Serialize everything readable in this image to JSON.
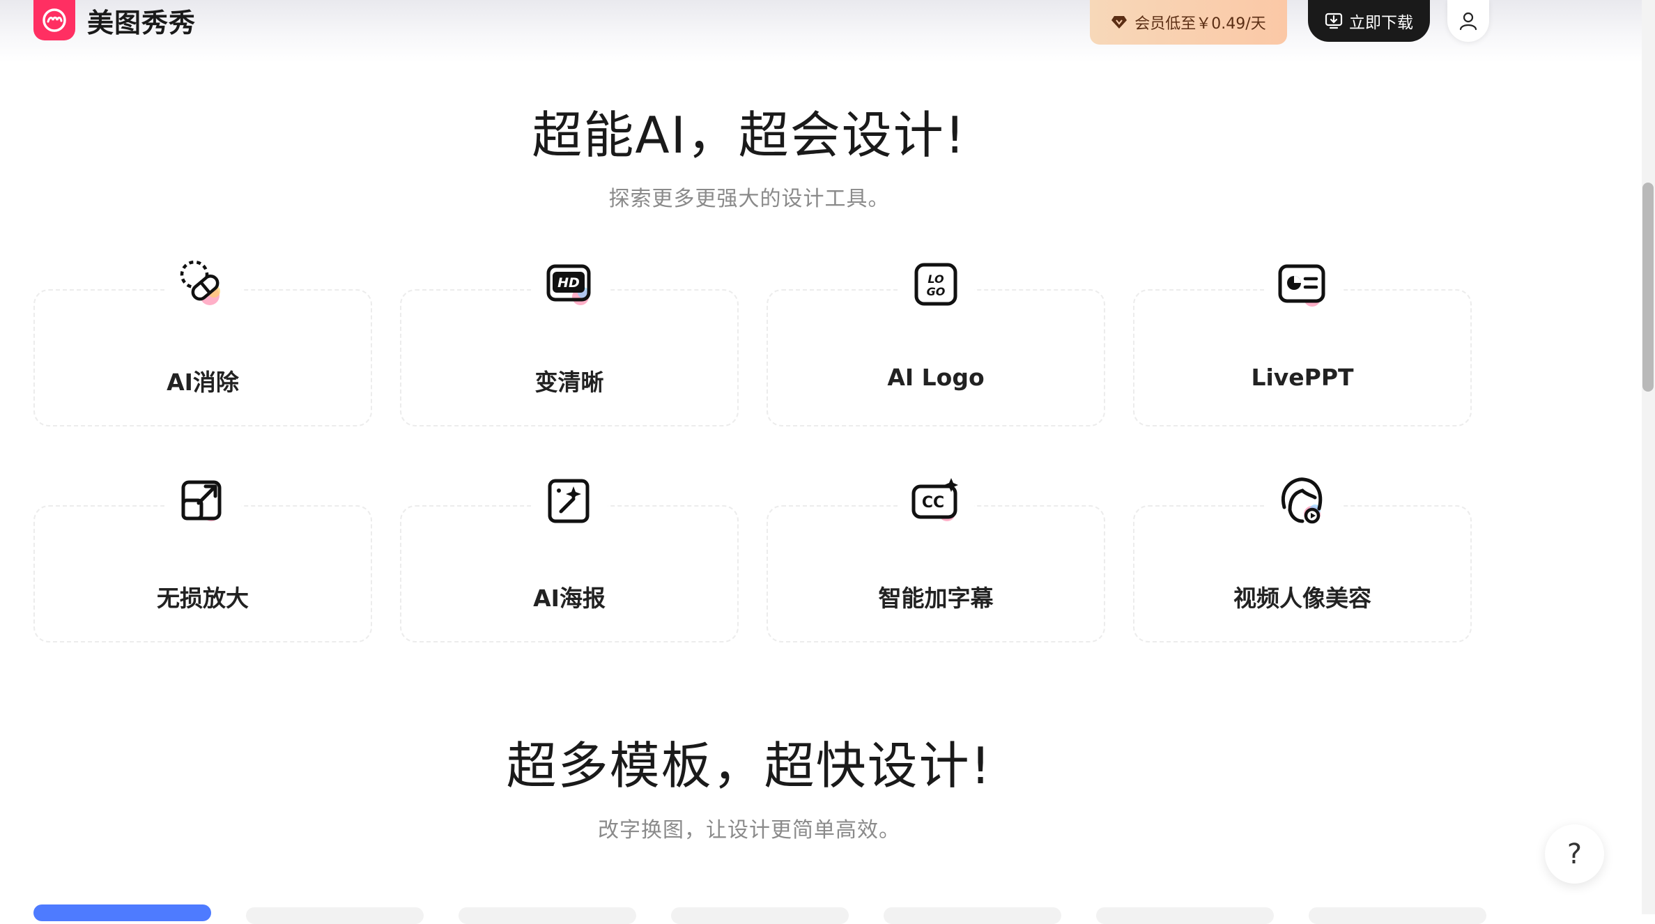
{
  "brand": {
    "name": "美图秀秀",
    "color": "#ff2f62"
  },
  "header": {
    "vip_promo": "会员低至￥0.49/天",
    "download_label": "立即下载"
  },
  "section_ai": {
    "title": "超能AI，超会设计!",
    "subtitle": "探索更多更强大的设计工具。"
  },
  "tools": [
    {
      "label": "AI消除",
      "icon": "eraser-icon"
    },
    {
      "label": "变清晰",
      "icon": "hd-icon"
    },
    {
      "label": "AI Logo",
      "icon": "logo-icon"
    },
    {
      "label": "LivePPT",
      "icon": "ppt-icon"
    },
    {
      "label": "无损放大",
      "icon": "upscale-icon"
    },
    {
      "label": "AI海报",
      "icon": "poster-icon"
    },
    {
      "label": "智能加字幕",
      "icon": "caption-icon"
    },
    {
      "label": "视频人像美容",
      "icon": "portrait-beauty-icon"
    }
  ],
  "section_templates": {
    "title": "超多模板，超快设计!",
    "subtitle": "改字换图，让设计更简单高效。"
  },
  "help": {
    "label": "?"
  },
  "colors": {
    "accent_blue": "#4e7bff",
    "dark": "#1a1a1a",
    "vip_bg": "#f9cfaf"
  }
}
